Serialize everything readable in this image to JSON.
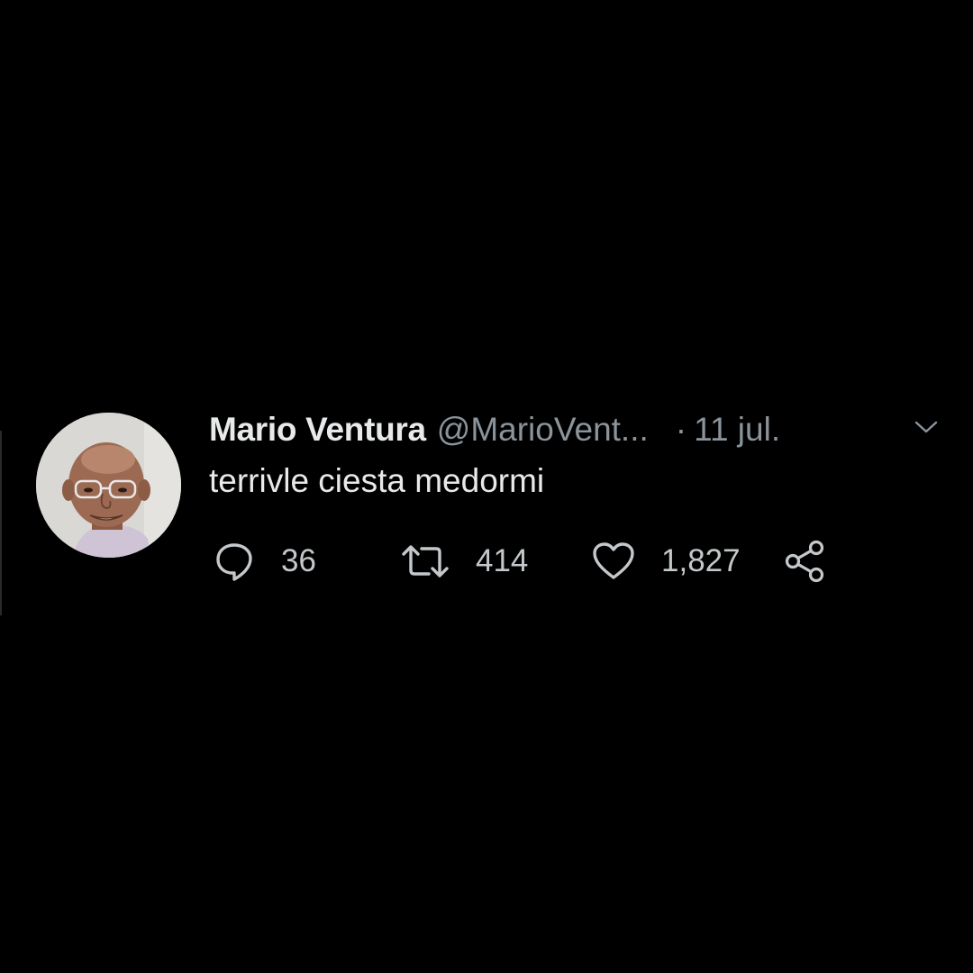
{
  "tweet": {
    "display_name": "Mario Ventura",
    "handle": "@MarioVent...",
    "separator": "·",
    "date": "11 jul.",
    "text": "terrivle ciesta medormi",
    "counts": {
      "replies": "36",
      "retweets": "414",
      "likes": "1,827"
    }
  },
  "icons": {
    "reply": "reply-bubble-icon",
    "retweet": "retweet-icon",
    "like": "heart-icon",
    "share": "share-icon",
    "menu": "chevron-down-icon"
  },
  "colors": {
    "background": "#000000",
    "primary_text": "#e7e9ea",
    "secondary_text": "#8b949b",
    "icon": "#c4c8cb"
  }
}
